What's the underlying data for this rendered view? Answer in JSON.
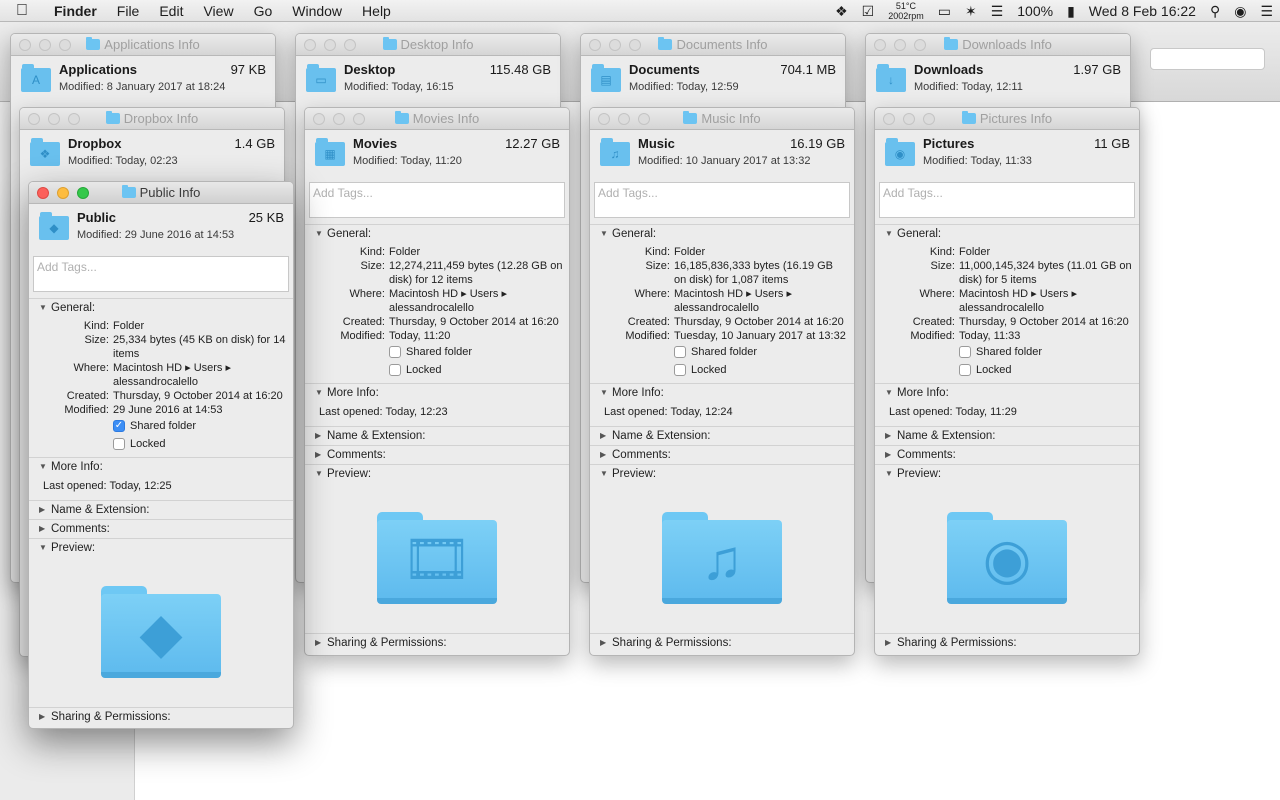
{
  "menubar": {
    "app": "Finder",
    "items": [
      "File",
      "Edit",
      "View",
      "Go",
      "Window",
      "Help"
    ],
    "temp_c": "51°C",
    "temp_rpm": "2002rpm",
    "battery": "100%",
    "datetime": "Wed 8 Feb  16:22"
  },
  "labels": {
    "tags_placeholder": "Add Tags...",
    "general": "General:",
    "kind": "Kind:",
    "size": "Size:",
    "where": "Where:",
    "created": "Created:",
    "modified": "Modified:",
    "shared_folder": "Shared folder",
    "locked": "Locked",
    "more_info": "More Info:",
    "name_ext": "Name & Extension:",
    "comments": "Comments:",
    "preview": "Preview:",
    "sharing": "Sharing & Permissions:"
  },
  "back_windows": [
    {
      "title": "Applications Info",
      "name": "Applications",
      "size": "97 KB",
      "modified": "Modified: 8 January 2017 at 18:24"
    },
    {
      "title": "Desktop Info",
      "name": "Desktop",
      "size": "115.48 GB",
      "modified": "Modified: Today, 16:15"
    },
    {
      "title": "Documents Info",
      "name": "Documents",
      "size": "704.1 MB",
      "modified": "Modified: Today, 12:59"
    },
    {
      "title": "Downloads Info",
      "name": "Downloads",
      "size": "1.97 GB",
      "modified": "Modified: Today, 12:11"
    },
    {
      "title": "Dropbox Info",
      "name": "Dropbox",
      "size": "1.4 GB",
      "modified": "Modified: Today, 02:23"
    }
  ],
  "windows": {
    "public": {
      "title": "Public Info",
      "name": "Public",
      "size": "25 KB",
      "modified": "Modified: 29 June 2016 at 14:53",
      "kind": "Folder",
      "size_detail": "25,334 bytes (45 KB on disk) for 14 items",
      "where": "Macintosh HD ▸ Users ▸ alessandrocalello",
      "created": "Thursday, 9 October 2014 at 16:20",
      "modified_detail": "29 June 2016 at 14:53",
      "shared": true,
      "locked": false,
      "last_opened": "Last opened: Today, 12:25"
    },
    "movies": {
      "title": "Movies Info",
      "name": "Movies",
      "size": "12.27 GB",
      "modified": "Modified: Today, 11:20",
      "kind": "Folder",
      "size_detail": "12,274,211,459 bytes (12.28 GB on disk) for 12 items",
      "where": "Macintosh HD ▸ Users ▸ alessandrocalello",
      "created": "Thursday, 9 October 2014 at 16:20",
      "modified_detail": "Today, 11:20",
      "shared": false,
      "locked": false,
      "last_opened": "Last opened: Today, 12:23"
    },
    "music": {
      "title": "Music Info",
      "name": "Music",
      "size": "16.19 GB",
      "modified": "Modified: 10 January 2017 at 13:32",
      "kind": "Folder",
      "size_detail": "16,185,836,333 bytes (16.19 GB on disk) for 1,087 items",
      "where": "Macintosh HD ▸ Users ▸ alessandrocalello",
      "created": "Thursday, 9 October 2014 at 16:20",
      "modified_detail": "Tuesday, 10 January 2017 at 13:32",
      "shared": false,
      "locked": false,
      "last_opened": "Last opened: Today, 12:24"
    },
    "pictures": {
      "title": "Pictures Info",
      "name": "Pictures",
      "size": "11 GB",
      "modified": "Modified: Today, 11:33",
      "kind": "Folder",
      "size_detail": "11,000,145,324 bytes (11.01 GB on disk) for 5 items",
      "where": "Macintosh HD ▸ Users ▸ alessandrocalello",
      "created": "Thursday, 9 October 2014 at 16:20",
      "modified_detail": "Today, 11:33",
      "shared": false,
      "locked": false,
      "last_opened": "Last opened: Today, 11:29"
    }
  }
}
